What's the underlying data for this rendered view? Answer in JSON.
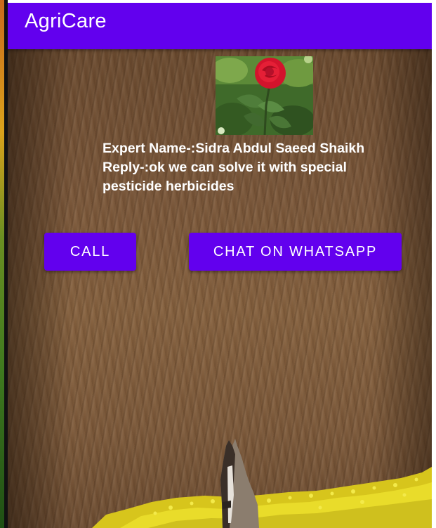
{
  "app": {
    "title": "AgriCare"
  },
  "expert": {
    "name_line": "Expert Name-:Sidra Abdul Saeed Shaikh",
    "reply_line1": "Reply-:ok we can solve it with special",
    "reply_line2": "pesticide herbicides"
  },
  "actions": {
    "call_label": "CALL",
    "whatsapp_label": "CHAT ON WHATSAPP"
  },
  "colors": {
    "primary": "#6200ee",
    "on_primary": "#ffffff",
    "text": "#ffffff"
  },
  "icons": {
    "photo": "red-rose-photo",
    "background": "plowed-field-with-horse-and-mustard-flowers"
  }
}
